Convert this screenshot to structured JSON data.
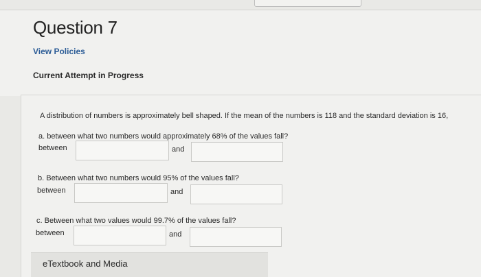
{
  "question": {
    "title": "Question 7",
    "view_policies": "View Policies",
    "attempt_status": "Current Attempt in Progress"
  },
  "prompt": "A distribution of numbers is approximately bell shaped. If the mean of the numbers is 118 and the standard deviation is 16,",
  "parts": [
    {
      "label": "a. between what two numbers would approximately 68% of the values fall?",
      "between": "between",
      "and": "and",
      "lower_value": "",
      "upper_value": ""
    },
    {
      "label": "b. Between what two numbers would 95% of the values fall?",
      "between": "between",
      "and": "and",
      "lower_value": "",
      "upper_value": ""
    },
    {
      "label": "c. Between what two values would 99.7% of the values fall?",
      "between": "between",
      "and": "and",
      "lower_value": "",
      "upper_value": ""
    }
  ],
  "footer": {
    "etextbook_label": "eTextbook and Media"
  }
}
